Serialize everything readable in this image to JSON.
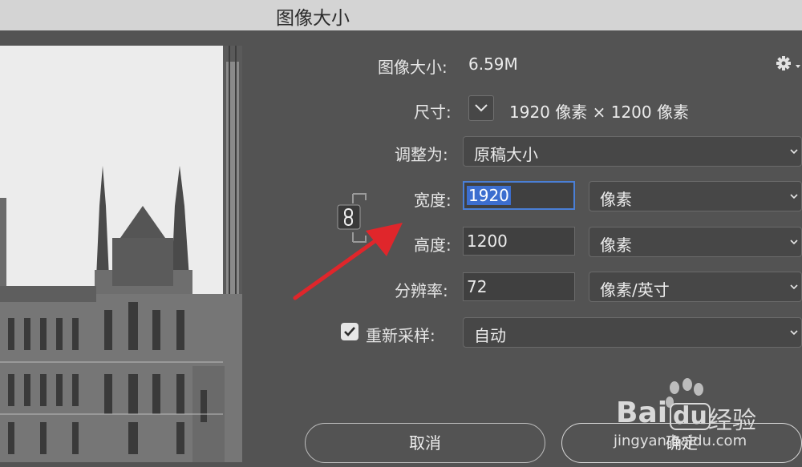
{
  "window": {
    "title": "图像大小"
  },
  "image_size": {
    "label": "图像大小:",
    "value": "6.59M"
  },
  "dimensions": {
    "label": "尺寸:",
    "value": "1920 像素  ×  1200 像素"
  },
  "fit_to": {
    "label": "调整为:",
    "value": "原稿大小"
  },
  "width": {
    "label": "宽度:",
    "value": "1920",
    "unit": "像素"
  },
  "height": {
    "label": "高度:",
    "value": "1200",
    "unit": "像素"
  },
  "resolution": {
    "label": "分辨率:",
    "value": "72",
    "unit": "像素/英寸"
  },
  "resample": {
    "label": "重新采样:",
    "checked": true,
    "value": "自动"
  },
  "buttons": {
    "cancel": "取消",
    "ok": "确定"
  },
  "watermark": {
    "brand_left": "Bai",
    "brand_right": "du",
    "suffix": "经验",
    "url": "jingyan.baidu.com"
  },
  "colors": {
    "background": "#535353",
    "titlebar": "#d4d4d4",
    "focus": "#4a7fd6",
    "arrow": "#e0262b"
  },
  "icons": [
    "gear-icon",
    "chevron-down-icon",
    "link-constrain-icon",
    "checkmark-icon"
  ]
}
